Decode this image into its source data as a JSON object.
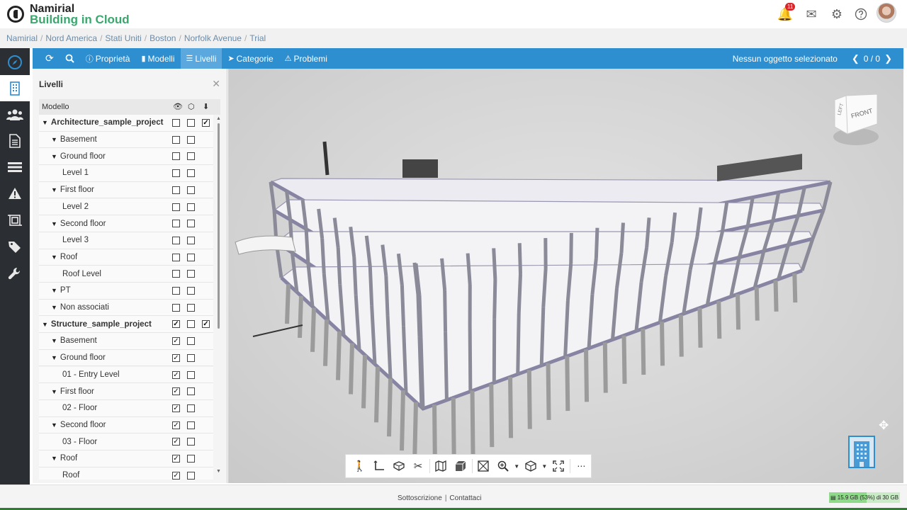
{
  "app": {
    "logo_line1": "Namirial",
    "logo_line2": "Building in Cloud",
    "notification_count": "11"
  },
  "breadcrumb": [
    "Namirial",
    "Nord America",
    "Stati Uniti",
    "Boston",
    "Norfolk Avenue",
    "Trial"
  ],
  "toolbar": {
    "proprieta": "Proprietà",
    "modelli": "Modelli",
    "livelli": "Livelli",
    "categorie": "Categorie",
    "problemi": "Problemi",
    "selection_status": "Nessun oggetto selezionato",
    "selection_count": "0 / 0"
  },
  "panel": {
    "title": "Livelli",
    "column_model": "Modello",
    "rows": [
      {
        "label": "Architecture_sample_project",
        "level": 0,
        "caret": true,
        "c1": false,
        "c2": false,
        "c3": true
      },
      {
        "label": "Basement",
        "level": 1,
        "caret": true,
        "c1": false,
        "c2": false
      },
      {
        "label": "Ground floor",
        "level": 1,
        "caret": true,
        "c1": false,
        "c2": false
      },
      {
        "label": "Level 1",
        "level": 2,
        "caret": false,
        "c1": false,
        "c2": false
      },
      {
        "label": "First floor",
        "level": 1,
        "caret": true,
        "c1": false,
        "c2": false
      },
      {
        "label": "Level 2",
        "level": 2,
        "caret": false,
        "c1": false,
        "c2": false
      },
      {
        "label": "Second floor",
        "level": 1,
        "caret": true,
        "c1": false,
        "c2": false
      },
      {
        "label": "Level 3",
        "level": 2,
        "caret": false,
        "c1": false,
        "c2": false
      },
      {
        "label": "Roof",
        "level": 1,
        "caret": true,
        "c1": false,
        "c2": false
      },
      {
        "label": "Roof Level",
        "level": 2,
        "caret": false,
        "c1": false,
        "c2": false
      },
      {
        "label": "PT",
        "level": 1,
        "caret": true,
        "c1": false,
        "c2": false
      },
      {
        "label": "Non associati",
        "level": 1,
        "caret": true,
        "c1": false,
        "c2": false
      },
      {
        "label": "Structure_sample_project",
        "level": 0,
        "caret": true,
        "c1": true,
        "c2": false,
        "c3": true
      },
      {
        "label": "Basement",
        "level": 1,
        "caret": true,
        "c1": true,
        "c2": false
      },
      {
        "label": "Ground floor",
        "level": 1,
        "caret": true,
        "c1": true,
        "c2": false
      },
      {
        "label": "01 - Entry Level",
        "level": 2,
        "caret": false,
        "c1": true,
        "c2": false
      },
      {
        "label": "First floor",
        "level": 1,
        "caret": true,
        "c1": true,
        "c2": false
      },
      {
        "label": "02 - Floor",
        "level": 2,
        "caret": false,
        "c1": true,
        "c2": false
      },
      {
        "label": "Second floor",
        "level": 1,
        "caret": true,
        "c1": true,
        "c2": false
      },
      {
        "label": "03 - Floor",
        "level": 2,
        "caret": false,
        "c1": true,
        "c2": false
      },
      {
        "label": "Roof",
        "level": 1,
        "caret": true,
        "c1": true,
        "c2": false
      },
      {
        "label": "Roof",
        "level": 2,
        "caret": false,
        "c1": true,
        "c2": false
      }
    ]
  },
  "viewcube": {
    "left_face": "LEFT",
    "front_face": "FRONT"
  },
  "footer": {
    "subscription": "Sottoscrizione",
    "contacts": "Contattaci",
    "storage": "15.9 GB (53%) di 30 GB",
    "storage_fraction": 0.53
  },
  "colors": {
    "accent": "#2e8fd0",
    "nav_bg": "#2b2f33",
    "brand_green": "#3aa76d",
    "badge": "#d9262c"
  }
}
